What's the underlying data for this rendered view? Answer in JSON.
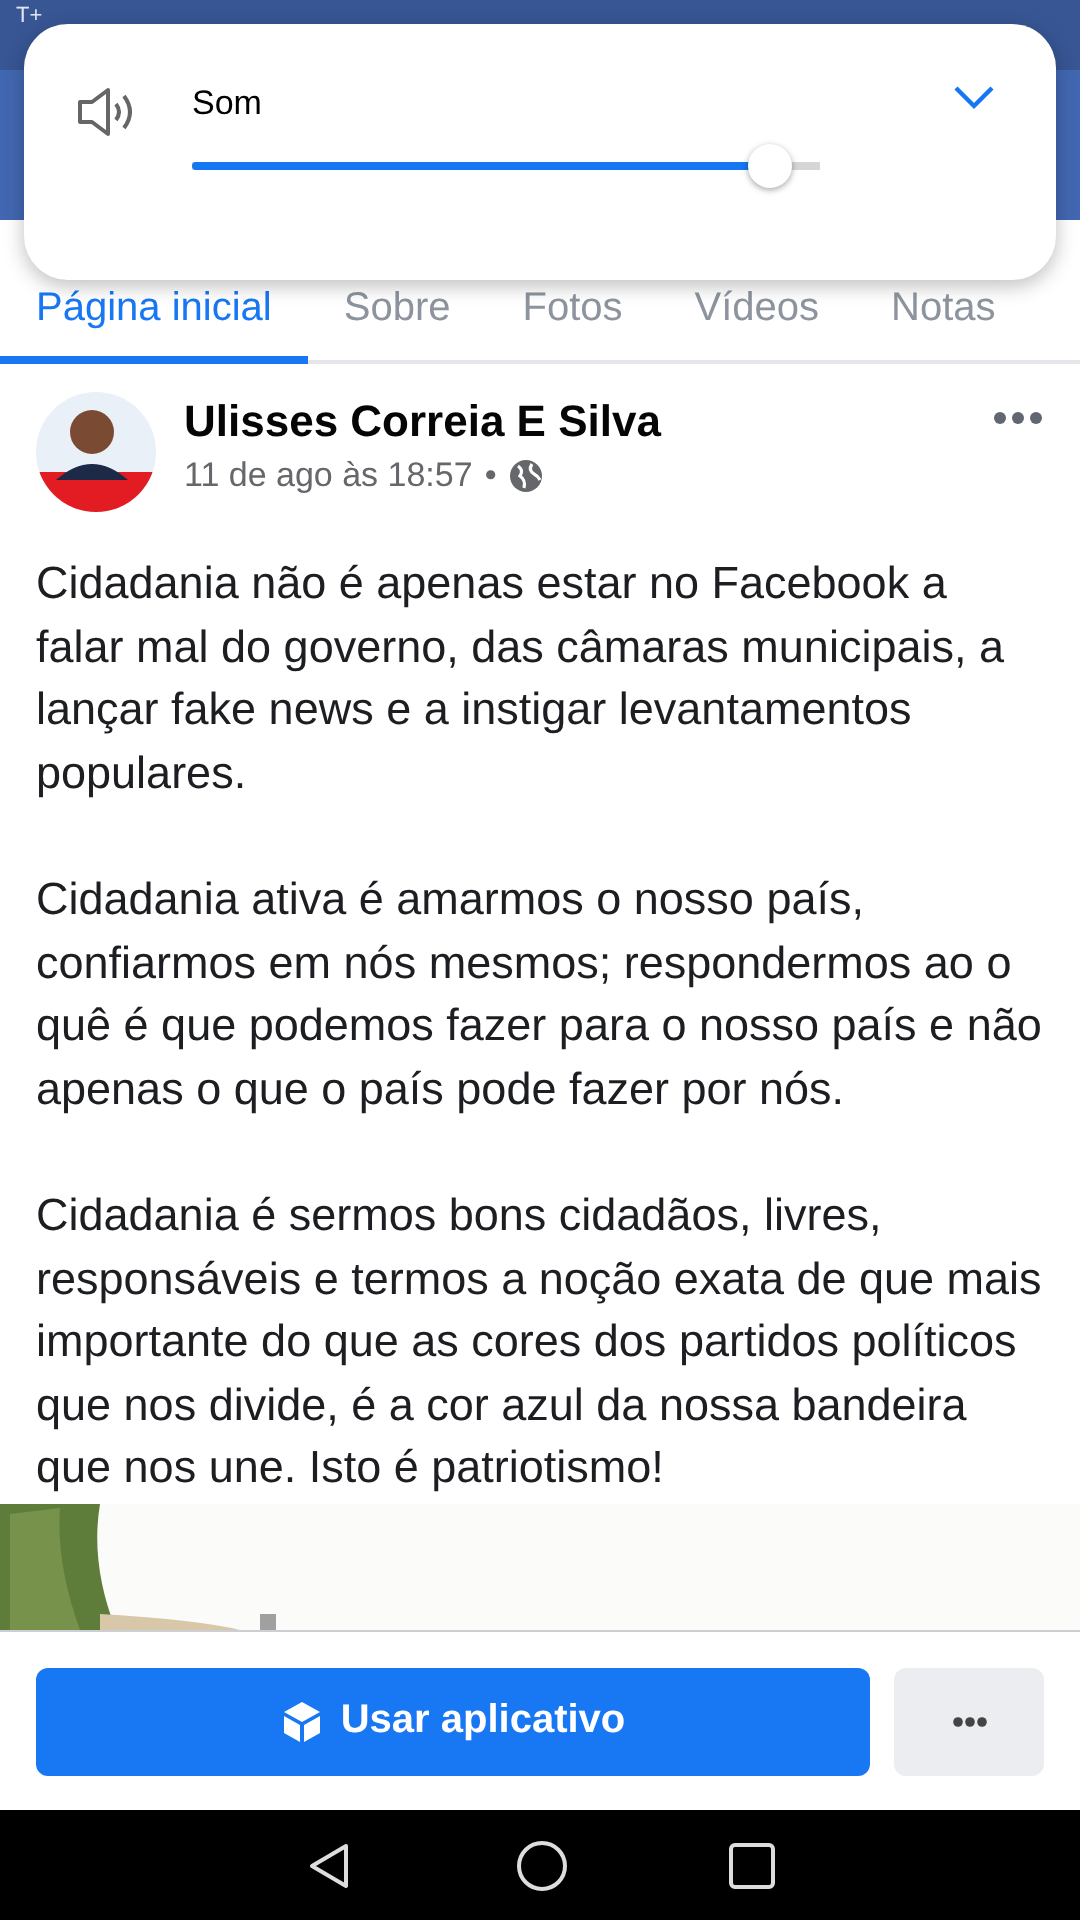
{
  "status_bar": {
    "carrier": "T+"
  },
  "volume_panel": {
    "label": "Som",
    "level": 0.92
  },
  "tabs": [
    {
      "label": "Página inicial",
      "selected": true
    },
    {
      "label": "Sobre",
      "selected": false
    },
    {
      "label": "Fotos",
      "selected": false
    },
    {
      "label": "Vídeos",
      "selected": false
    },
    {
      "label": "Notas",
      "selected": false
    }
  ],
  "post": {
    "author": "Ulisses Correia E Silva",
    "time": "11 de ago às 18:57",
    "separator": "•",
    "paragraphs": [
      "Cidadania não é apenas estar no Facebook a falar mal do governo, das câmaras municipais, a lançar fake news e a instigar levantamentos populares.",
      "Cidadania ativa é amarmos o nosso país, confiarmos em nós mesmos; respondermos ao o quê é que podemos fazer para o nosso país e não apenas o que o país pode fazer por nós.",
      "Cidadania é sermos bons cidadãos, livres, responsáveis e termos a noção exata de que mais importante do que as cores dos partidos políticos que nos divide, é a cor azul da nossa bandeira que nos une. Isto é patriotismo!"
    ]
  },
  "bottom_bar": {
    "primary_button": "Usar aplicativo"
  }
}
